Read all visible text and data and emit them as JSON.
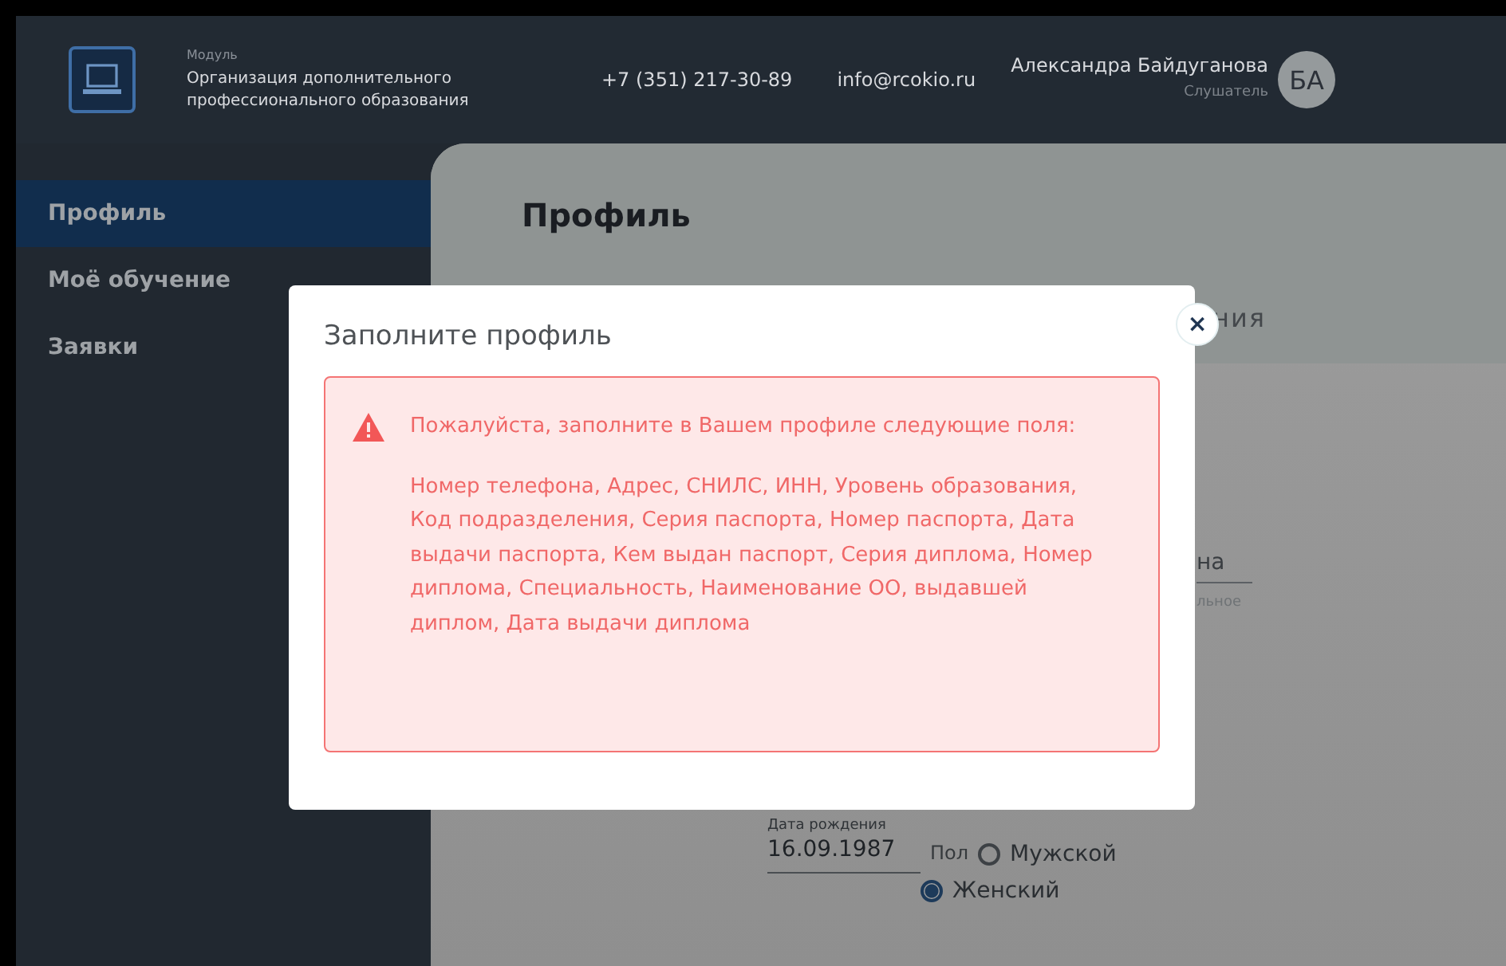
{
  "header": {
    "module_label": "Модуль",
    "organization": "Организация дополнительного профессионального образования",
    "phone": "+7 (351) 217-30-89",
    "email": "info@rcokio.ru",
    "user": {
      "name": "Александра Байдуганова",
      "role": "Слушатель",
      "initials": "БА"
    }
  },
  "sidebar": {
    "items": [
      {
        "label": "Профиль",
        "selected": true
      },
      {
        "label": "Моё обучение",
        "selected": false
      },
      {
        "label": "Заявки",
        "selected": false
      }
    ]
  },
  "page": {
    "title": "Профиль",
    "tab_fragment": "ния",
    "field_fragment": {
      "value": "на",
      "hint": "льное"
    },
    "birth_date": {
      "label": "Дата рождения",
      "value": "16.09.1987"
    },
    "gender": {
      "label": "Пол",
      "options": [
        {
          "label": "Мужской",
          "selected": false
        },
        {
          "label": "Женский",
          "selected": true
        }
      ]
    }
  },
  "modal": {
    "title": "Заполните профиль",
    "close": "×",
    "alert": {
      "message": "Пожалуйста, заполните в Вашем профиле следующие поля:",
      "fields": "Номер телефона, Адрес, СНИЛС, ИНН, Уровень образования, Код подразделения, Серия паспорта, Номер паспорта, Дата выдачи паспорта, Кем выдан паспорт, Серия диплома, Номер диплома, Специальность, Наименование ОО, выдавшей диплом, Дата выдачи диплома"
    }
  }
}
